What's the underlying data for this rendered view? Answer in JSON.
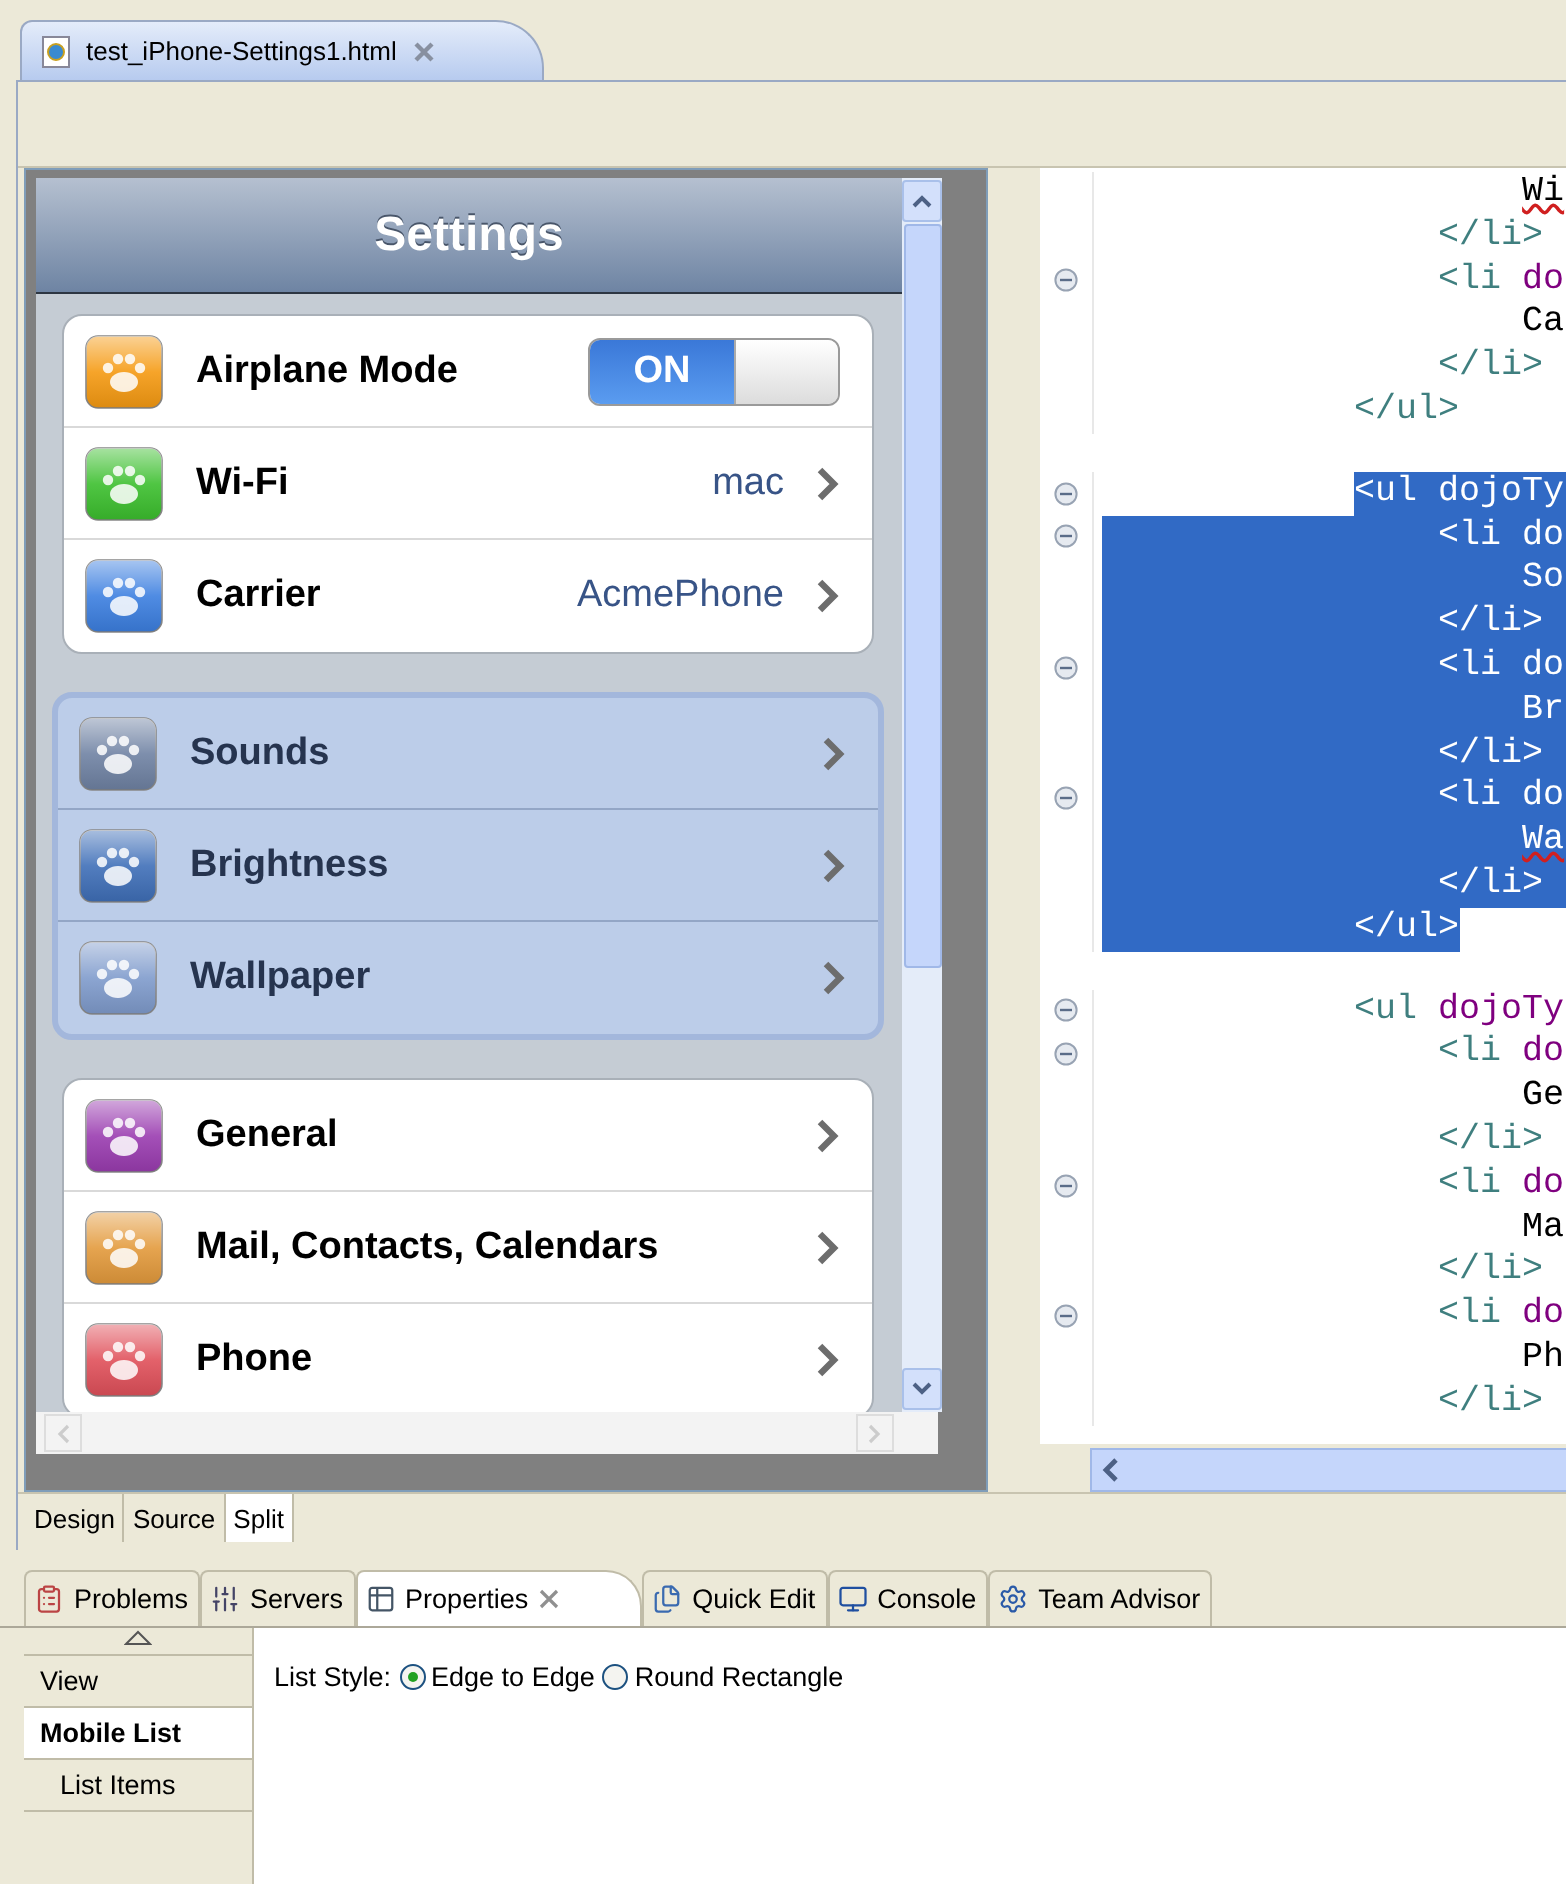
{
  "editor_tab": {
    "title": "test_iPhone-Settings1.html",
    "selected": true
  },
  "preview": {
    "title": "Settings",
    "groups": [
      {
        "selected": false,
        "rows": [
          {
            "kind": "toggle",
            "label": "Airplane Mode",
            "color": "#f59a12",
            "toggle": {
              "text": "ON",
              "on": true
            }
          },
          {
            "kind": "link",
            "label": "Wi-Fi",
            "color": "#3cbf2e",
            "value": "mac"
          },
          {
            "kind": "link",
            "label": "Carrier",
            "color": "#3c7fe0",
            "value": "AcmePhone"
          }
        ]
      },
      {
        "selected": true,
        "rows": [
          {
            "kind": "link",
            "label": "Sounds",
            "color": "#6f82a3"
          },
          {
            "kind": "link",
            "label": "Brightness",
            "color": "#3f6fb8"
          },
          {
            "kind": "link",
            "label": "Wallpaper",
            "color": "#7f9bcc"
          }
        ]
      },
      {
        "selected": false,
        "rows": [
          {
            "kind": "link",
            "label": "General",
            "color": "#9a3cb0"
          },
          {
            "kind": "link",
            "label": "Mail, Contacts, Calendars",
            "color": "#e39a3c"
          },
          {
            "kind": "link",
            "label": "Phone",
            "color": "#e0505a"
          }
        ]
      }
    ]
  },
  "code": {
    "lines": [
      {
        "text": "                    Wi",
        "fold": false,
        "selected": false,
        "misspelled": true
      },
      {
        "text": "                </li>",
        "fold": false,
        "selected": false
      },
      {
        "text": "                <li do",
        "fold": true,
        "selected": false
      },
      {
        "text": "                    Ca",
        "fold": false,
        "selected": false
      },
      {
        "text": "                </li>",
        "fold": false,
        "selected": false
      },
      {
        "text": "            </ul>",
        "fold": false,
        "selected": false
      },
      {
        "text": "            <ul dojoTy",
        "fold": true,
        "selected": true,
        "blank_before": true
      },
      {
        "text": "                <li do",
        "fold": true,
        "selected": true
      },
      {
        "text": "                    So",
        "fold": false,
        "selected": true
      },
      {
        "text": "                </li>",
        "fold": false,
        "selected": true
      },
      {
        "text": "                <li do",
        "fold": true,
        "selected": true
      },
      {
        "text": "                    Br",
        "fold": false,
        "selected": true
      },
      {
        "text": "                </li>",
        "fold": false,
        "selected": true
      },
      {
        "text": "                <li do",
        "fold": true,
        "selected": true
      },
      {
        "text": "                    Wa",
        "fold": false,
        "selected": true,
        "misspelled": true
      },
      {
        "text": "                </li>",
        "fold": false,
        "selected": true
      },
      {
        "text": "            </ul>",
        "fold": false,
        "selected": true
      },
      {
        "text": "            <ul dojoTy",
        "fold": true,
        "selected": false,
        "blank_before": true
      },
      {
        "text": "                <li do",
        "fold": true,
        "selected": false
      },
      {
        "text": "                    Ge",
        "fold": false,
        "selected": false
      },
      {
        "text": "                </li>",
        "fold": false,
        "selected": false
      },
      {
        "text": "                <li do",
        "fold": true,
        "selected": false
      },
      {
        "text": "                    Ma",
        "fold": false,
        "selected": false
      },
      {
        "text": "                </li>",
        "fold": false,
        "selected": false
      },
      {
        "text": "                <li do",
        "fold": true,
        "selected": false
      },
      {
        "text": "                    Ph",
        "fold": false,
        "selected": false
      },
      {
        "text": "                </li>",
        "fold": false,
        "selected": false
      }
    ]
  },
  "mode_tabs": [
    {
      "label": "Design",
      "selected": false
    },
    {
      "label": "Source",
      "selected": false
    },
    {
      "label": "Split",
      "selected": true
    }
  ],
  "view_tabs": [
    {
      "kind": "problems",
      "label": "Problems",
      "selected": false
    },
    {
      "kind": "servers",
      "label": "Servers",
      "selected": false
    },
    {
      "kind": "properties",
      "label": "Properties",
      "selected": true
    },
    {
      "kind": "quickedit",
      "label": "Quick Edit",
      "selected": false
    },
    {
      "kind": "console",
      "label": "Console",
      "selected": false
    },
    {
      "kind": "advisor",
      "label": "Team Advisor",
      "selected": false
    }
  ],
  "properties": {
    "sections": [
      {
        "label": "View",
        "selected": false
      },
      {
        "label": "Mobile List",
        "selected": true
      },
      {
        "label": "List Items",
        "selected": false
      }
    ],
    "field_label": "List Style:",
    "options": [
      {
        "label": "Edge to Edge",
        "checked": true
      },
      {
        "label": "Round Rectangle",
        "checked": false
      }
    ]
  }
}
